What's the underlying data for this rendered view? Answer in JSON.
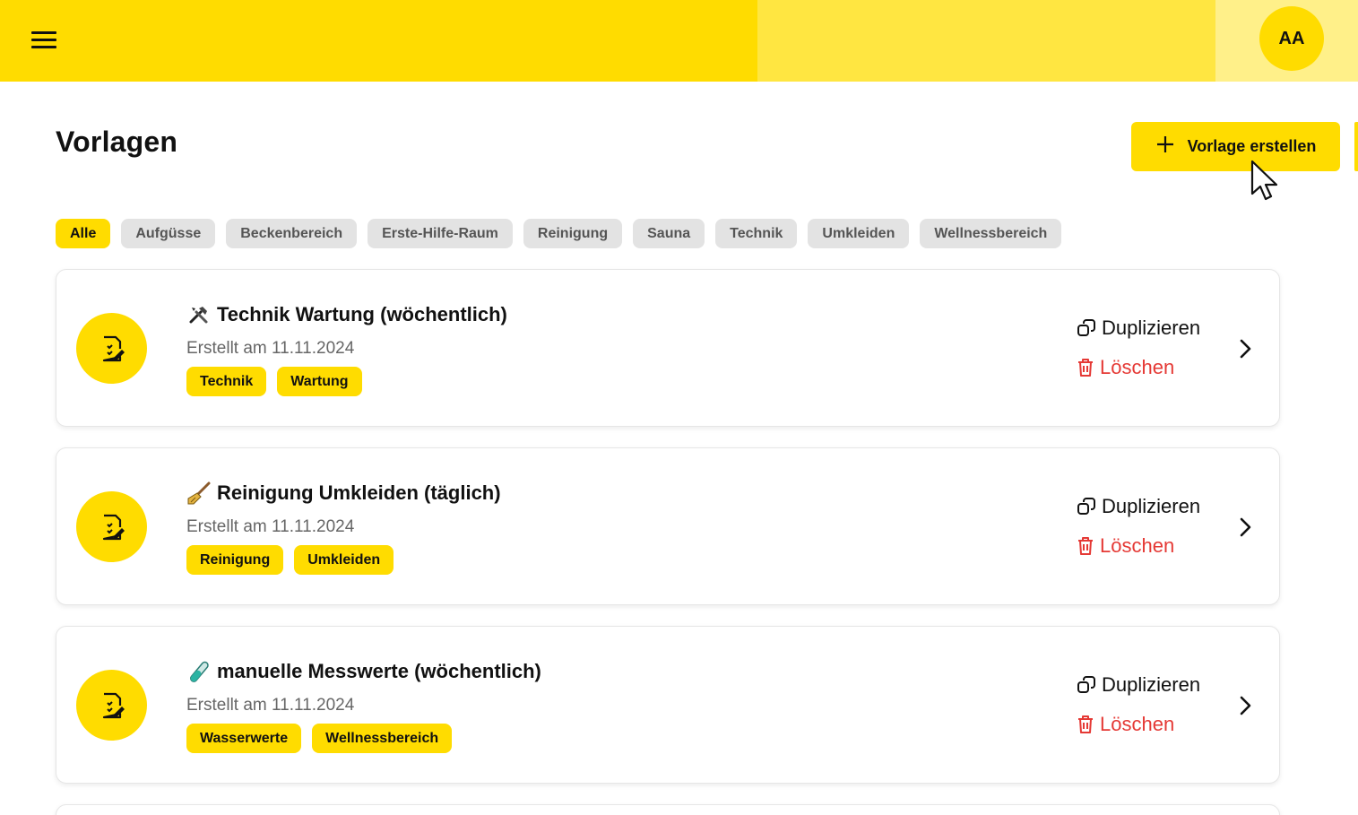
{
  "header": {
    "menu_icon": "menu-icon",
    "avatar_initials": "AA",
    "colors": {
      "primary": "#FFDC00",
      "mid": "#FFE641",
      "light": "#FFF089"
    }
  },
  "page": {
    "title": "Vorlagen",
    "create_button_label": "Vorlage erstellen",
    "create_button_icon": "plus-icon"
  },
  "filters": [
    {
      "label": "Alle",
      "active": true
    },
    {
      "label": "Aufgüsse",
      "active": false
    },
    {
      "label": "Beckenbereich",
      "active": false
    },
    {
      "label": "Erste-Hilfe-Raum",
      "active": false
    },
    {
      "label": "Reinigung",
      "active": false
    },
    {
      "label": "Sauna",
      "active": false
    },
    {
      "label": "Technik",
      "active": false
    },
    {
      "label": "Umkleiden",
      "active": false
    },
    {
      "label": "Wellnessbereich",
      "active": false
    }
  ],
  "templates": [
    {
      "icon": "tools-icon",
      "title": "Technik Wartung (wöchentlich)",
      "date": "Erstellt am 11.11.2024",
      "tags": [
        "Technik",
        "Wartung"
      ],
      "duplicate_label": "Duplizieren",
      "delete_label": "Löschen"
    },
    {
      "icon": "broom-icon",
      "title": "Reinigung Umkleiden (täglich)",
      "date": "Erstellt am 11.11.2024",
      "tags": [
        "Reinigung",
        "Umkleiden"
      ],
      "duplicate_label": "Duplizieren",
      "delete_label": "Löschen"
    },
    {
      "icon": "test-tube-icon",
      "title": "manuelle Messwerte (wöchentlich)",
      "date": "Erstellt am 11.11.2024",
      "tags": [
        "Wasserwerte",
        "Wellnessbereich"
      ],
      "duplicate_label": "Duplizieren",
      "delete_label": "Löschen"
    }
  ],
  "colors": {
    "accent": "#FFDC00",
    "danger": "#E53935",
    "chip_bg": "#E3E3E3"
  }
}
